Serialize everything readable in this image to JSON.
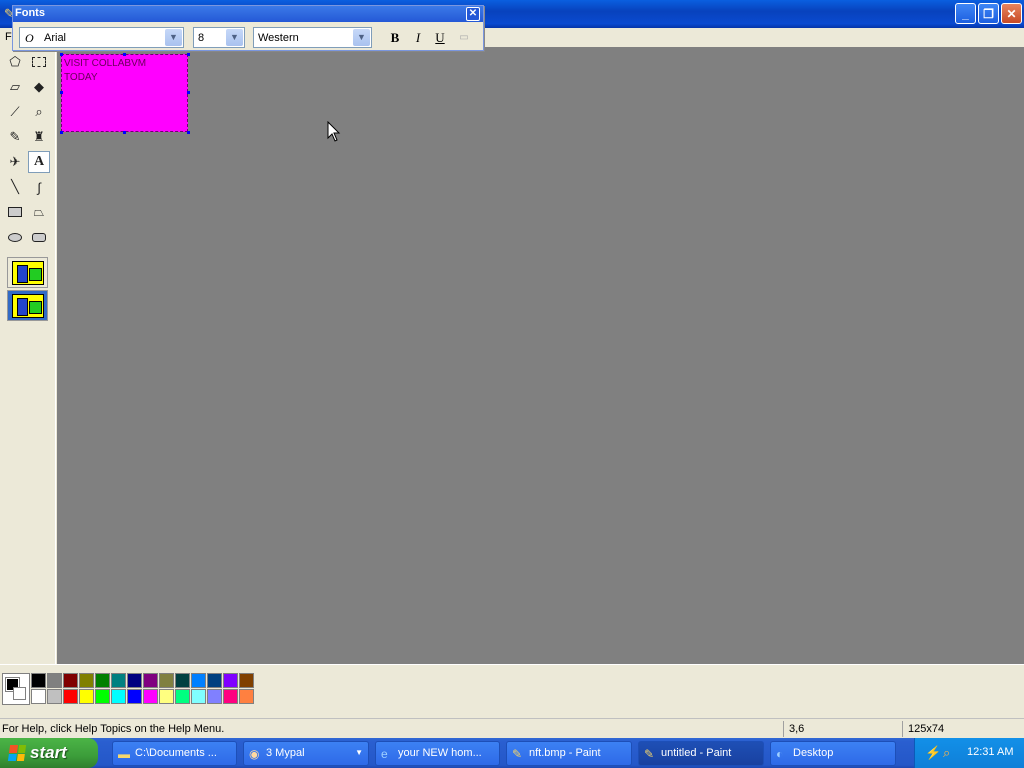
{
  "window": {
    "title": ""
  },
  "menubar": {
    "visible_letter": "F"
  },
  "fonts_toolbar": {
    "title": "Fonts",
    "font_name": "Arial",
    "font_size": "8",
    "script": "Western",
    "bold_label": "B",
    "italic_label": "I",
    "underline_label": "U"
  },
  "canvas": {
    "text_line1": "VISIT COLLABVM",
    "text_line2": "TODAY",
    "text_box_color": "#ff00ff",
    "background_color": "#808080"
  },
  "palette": {
    "top_row": [
      "#000000",
      "#808080",
      "#800000",
      "#808000",
      "#008000",
      "#008080",
      "#000080",
      "#800080",
      "#808040",
      "#004040",
      "#0080ff",
      "#004080",
      "#8000ff",
      "#804000"
    ],
    "bottom_row": [
      "#ffffff",
      "#c0c0c0",
      "#ff0000",
      "#ffff00",
      "#00ff00",
      "#00ffff",
      "#0000ff",
      "#ff00ff",
      "#ffff80",
      "#00ff80",
      "#80ffff",
      "#8080ff",
      "#ff0080",
      "#ff8040"
    ],
    "foreground": "#000000",
    "background": "#ffffff"
  },
  "status": {
    "help_text": "For Help, click Help Topics on the Help Menu.",
    "coords": "3,6",
    "size": "125x74"
  },
  "taskbar": {
    "start_label": "start",
    "items": [
      {
        "label": "C:\\Documents ...",
        "icon": "folder-icon"
      },
      {
        "label": "3 Mypal",
        "icon": "browser-icon"
      },
      {
        "label": "your NEW hom...",
        "icon": "ie-icon"
      },
      {
        "label": "nft.bmp - Paint",
        "icon": "paint-icon"
      },
      {
        "label": "untitled - Paint",
        "icon": "paint-icon"
      },
      {
        "label": "Desktop",
        "icon": "desktop-icon"
      }
    ],
    "clock": "12:31 AM"
  }
}
